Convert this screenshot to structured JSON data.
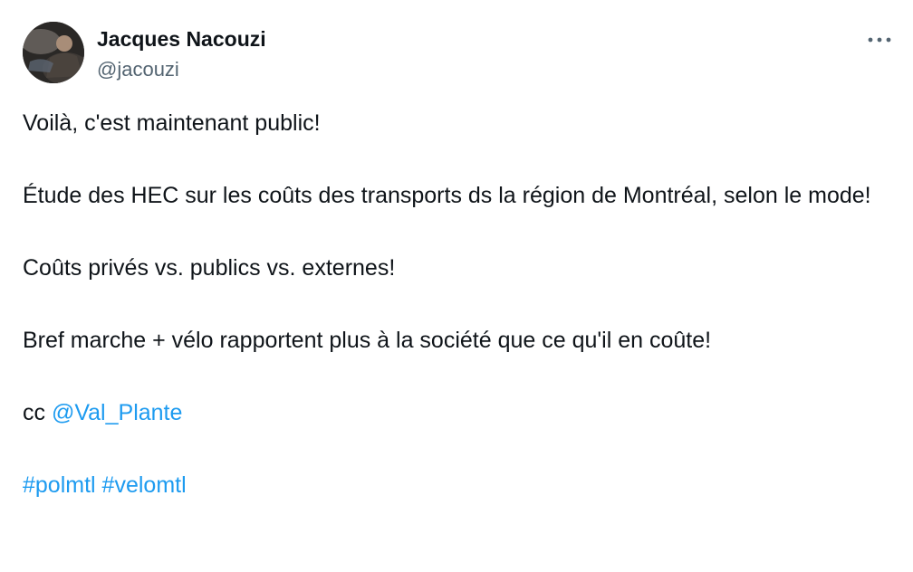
{
  "author": {
    "display_name": "Jacques Nacouzi",
    "handle": "@jacouzi"
  },
  "icons": {
    "avatar": "avatar-photo",
    "more": "more-icon"
  },
  "colors": {
    "text": "#0f1419",
    "secondary": "#536471",
    "link": "#1d9bf0"
  },
  "tweet": {
    "line1": "Voilà, c'est maintenant public!",
    "line2": "Étude des HEC sur les coûts des transports ds la région de Montréal, selon le mode!",
    "line3": "Coûts privés vs. publics vs. externes!",
    "line4": "Bref marche + vélo rapportent plus à la société que ce qu'il en coûte!",
    "cc_prefix": "cc ",
    "mention": "@Val_Plante",
    "hashtag1": "#polmtl",
    "hashtag2": "#velomtl"
  }
}
